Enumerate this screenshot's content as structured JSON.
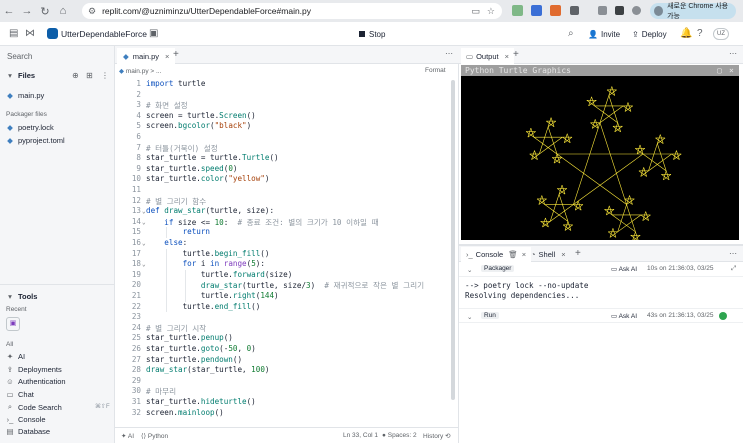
{
  "browser": {
    "url": "replit.com/@uzniminzu/UtterDependableForce#main.py",
    "profile_label": "새로운 Chrome 사용 가능",
    "colors": {
      "bar": "#e8eaed",
      "profile_bg": "#c6e0ee"
    }
  },
  "header": {
    "repo_name": "UtterDependableForce",
    "stop_label": "Stop",
    "invite_label": "Invite",
    "deploy_label": "Deploy",
    "user_initials": "UZ"
  },
  "sidebar": {
    "search_placeholder": "Search",
    "files_label": "Files",
    "files": [
      "main.py"
    ],
    "packager_label": "Packager files",
    "packager_files": [
      "poetry.lock",
      "pyproject.toml"
    ],
    "tools_label": "Tools",
    "recent_label": "Recent",
    "all_label": "All",
    "tools": [
      {
        "label": "AI",
        "icon": "sparkle-icon"
      },
      {
        "label": "Deployments",
        "icon": "deploy-icon"
      },
      {
        "label": "Authentication",
        "icon": "user-icon"
      },
      {
        "label": "Chat",
        "icon": "chat-icon"
      },
      {
        "label": "Code Search",
        "icon": "search-icon",
        "shortcut": "⌘⇧F"
      },
      {
        "label": "Console",
        "icon": "terminal-icon"
      },
      {
        "label": "Database",
        "icon": "database-icon"
      }
    ]
  },
  "editor": {
    "tab_label": "main.py",
    "breadcrumb": "main.py > ...",
    "format_label": "Format",
    "status": {
      "ai": "AI",
      "language": "Python",
      "position": "Ln 33, Col 1",
      "spaces": "Spaces: 2",
      "history": "History"
    },
    "lines": [
      {
        "n": "1",
        "text": "import turtle"
      },
      {
        "n": "2",
        "text": ""
      },
      {
        "n": "3",
        "text": "# 화면 설정"
      },
      {
        "n": "4",
        "text": "screen = turtle.Screen()"
      },
      {
        "n": "5",
        "text": "screen.bgcolor(\"black\")"
      },
      {
        "n": "6",
        "text": ""
      },
      {
        "n": "7",
        "text": "# 터틀(거북이) 설정"
      },
      {
        "n": "8",
        "text": "star_turtle = turtle.Turtle()"
      },
      {
        "n": "9",
        "text": "star_turtle.speed(0)"
      },
      {
        "n": "10",
        "text": "star_turtle.color(\"yellow\")"
      },
      {
        "n": "11",
        "text": ""
      },
      {
        "n": "12",
        "text": "# 별 그리기 함수"
      },
      {
        "n": "13",
        "text": "def draw_star(turtle, size):"
      },
      {
        "n": "14",
        "text": "    if size <= 10:  # 종료 조건: 별의 크기가 10 이하일 때"
      },
      {
        "n": "15",
        "text": "        return"
      },
      {
        "n": "16",
        "text": "    else:"
      },
      {
        "n": "17",
        "text": "        turtle.begin_fill()"
      },
      {
        "n": "18",
        "text": "        for i in range(5):"
      },
      {
        "n": "19",
        "text": "            turtle.forward(size)"
      },
      {
        "n": "20",
        "text": "            draw_star(turtle, size/3)  # 재귀적으로 작은 별 그리기"
      },
      {
        "n": "21",
        "text": "            turtle.right(144)"
      },
      {
        "n": "22",
        "text": "        turtle.end_fill()"
      },
      {
        "n": "23",
        "text": ""
      },
      {
        "n": "24",
        "text": "# 별 그리기 시작"
      },
      {
        "n": "25",
        "text": "star_turtle.penup()"
      },
      {
        "n": "26",
        "text": "star_turtle.goto(-50, 0)"
      },
      {
        "n": "27",
        "text": "star_turtle.pendown()"
      },
      {
        "n": "28",
        "text": "draw_star(star_turtle, 100)"
      },
      {
        "n": "29",
        "text": ""
      },
      {
        "n": "30",
        "text": "# 마무리"
      },
      {
        "n": "31",
        "text": "star_turtle.hideturtle()"
      },
      {
        "n": "32",
        "text": "screen.mainloop()"
      }
    ]
  },
  "output": {
    "tab_label": "Output",
    "turtle_title": "Python Turtle Graphics",
    "star_color": "#ffeb3b"
  },
  "console": {
    "tab_label": "Console",
    "shell_tab_label": "Shell",
    "packager": {
      "label": "Packager",
      "ask_ai": "Ask AI",
      "time": "10s on 21:36:03, 03/25",
      "output": [
        "--> poetry lock --no-update",
        "Resolving dependencies..."
      ]
    },
    "run": {
      "label": "Run",
      "ask_ai": "Ask AI",
      "time": "43s on 21:36:13, 03/25",
      "status_color": "#2ea44f"
    }
  }
}
